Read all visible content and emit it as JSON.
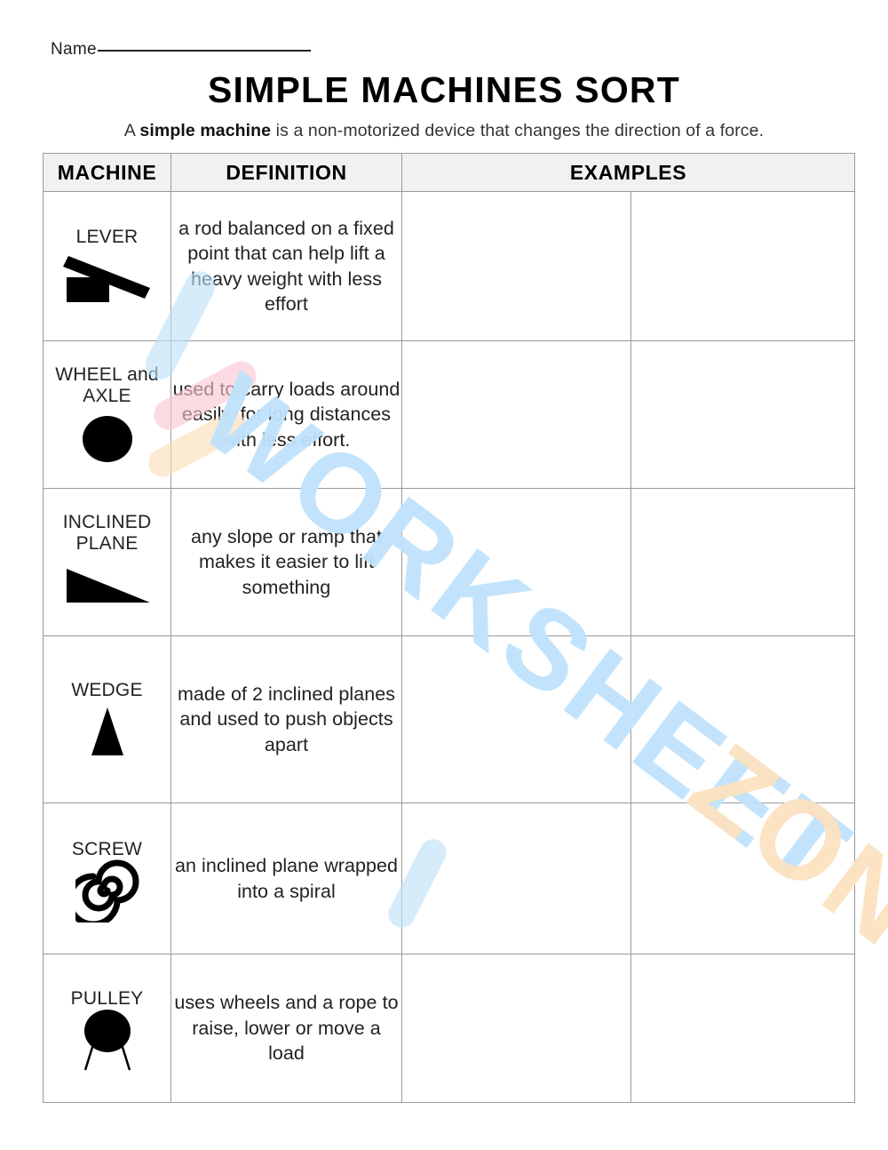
{
  "header": {
    "name_label": "Name",
    "title": "SIMPLE MACHINES SORT",
    "subtitle_before": "A ",
    "subtitle_bold": "simple machine",
    "subtitle_after": " is a non-motorized device that changes the direction of a force."
  },
  "table": {
    "columns": [
      "MACHINE",
      "DEFINITION",
      "EXAMPLES"
    ],
    "rows": [
      {
        "machine": "LEVER",
        "icon": "lever-icon",
        "definition": "a rod balanced on a fixed point that can help lift a heavy weight with less effort",
        "example_1": "",
        "example_2": ""
      },
      {
        "machine": "WHEEL and AXLE",
        "icon": "wheel-and-axle-icon",
        "definition": "used to carry loads around easily, for long distances with less effort.",
        "example_1": "",
        "example_2": ""
      },
      {
        "machine": "INCLINED PLANE",
        "icon": "inclined-plane-icon",
        "definition": "any slope or ramp that makes it easier to lift something",
        "example_1": "",
        "example_2": ""
      },
      {
        "machine": "WEDGE",
        "icon": "wedge-icon",
        "definition": "made of 2 inclined planes and used to push objects apart",
        "example_1": "",
        "example_2": ""
      },
      {
        "machine": "SCREW",
        "icon": "screw-icon",
        "definition": "an inclined plane wrapped into a spiral",
        "example_1": "",
        "example_2": ""
      },
      {
        "machine": "PULLEY",
        "icon": "pulley-icon",
        "definition": "uses wheels and a rope to raise, lower or move a load",
        "example_1": "",
        "example_2": ""
      }
    ]
  },
  "watermark": {
    "text_primary": "WORKSHEET",
    "text_secondary": "ZONE",
    "color_primary": "#bfe2fb",
    "color_secondary": "#fbe2c0",
    "logo_colors": [
      "#bfe0f7",
      "#f9c5cf",
      "#fbdfb7"
    ]
  },
  "colors": {
    "header_fill": "#f1f1f1",
    "grid_line": "#9a9a9a",
    "text": "#222222",
    "page_background": "#ffffff"
  }
}
